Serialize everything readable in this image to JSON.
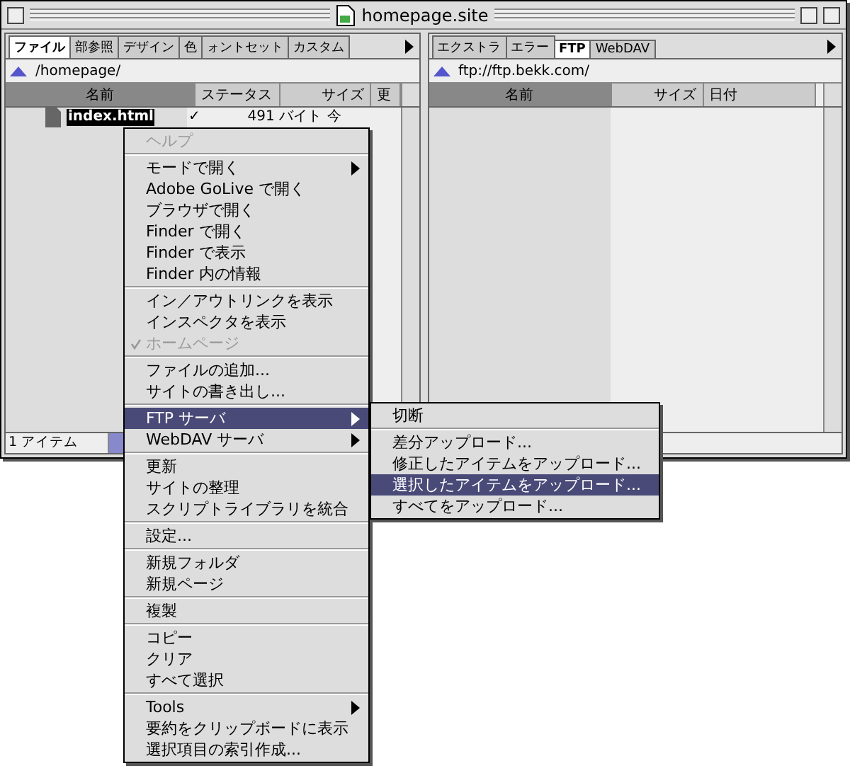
{
  "window": {
    "title": "homepage.site"
  },
  "left_pane": {
    "tabs": [
      {
        "label": "ファイル",
        "selected": true
      },
      {
        "label": "部参照",
        "selected": false
      },
      {
        "label": "デザイン",
        "selected": false
      },
      {
        "label": "色",
        "selected": false
      },
      {
        "label": "ォントセット",
        "selected": false
      },
      {
        "label": "カスタム",
        "selected": false
      }
    ],
    "path": "/homepage/",
    "columns": [
      {
        "label": "名前",
        "sorted": true
      },
      {
        "label": "ステータス",
        "sorted": false
      },
      {
        "label": "サイズ",
        "sorted": false
      },
      {
        "label": "更",
        "sorted": false
      }
    ],
    "rows": [
      {
        "name": "index.html",
        "status": "✓",
        "size": "491 バイト",
        "modified": "今",
        "selected": true
      }
    ],
    "status_bar": "1 アイテム"
  },
  "right_pane": {
    "tabs": [
      {
        "label": "エクストラ",
        "selected": false
      },
      {
        "label": "エラー",
        "selected": false
      },
      {
        "label": "FTP",
        "selected": true
      },
      {
        "label": "WebDAV",
        "selected": false
      }
    ],
    "path": "ftp://ftp.bekk.com/",
    "columns": [
      {
        "label": "名前",
        "sorted": true
      },
      {
        "label": "サイズ",
        "sorted": false
      },
      {
        "label": "日付",
        "sorted": false
      }
    ]
  },
  "context_menu": {
    "sections": [
      [
        {
          "label": "ヘルプ",
          "disabled": true,
          "checked": false,
          "submenu": false,
          "selected": false
        }
      ],
      [
        {
          "label": "モードで開く",
          "disabled": false,
          "checked": false,
          "submenu": true,
          "selected": false
        },
        {
          "label": "Adobe GoLive で開く",
          "disabled": false,
          "checked": false,
          "submenu": false,
          "selected": false
        },
        {
          "label": "ブラウザで開く",
          "disabled": false,
          "checked": false,
          "submenu": false,
          "selected": false
        },
        {
          "label": "Finder で開く",
          "disabled": false,
          "checked": false,
          "submenu": false,
          "selected": false
        },
        {
          "label": "Finder で表示",
          "disabled": false,
          "checked": false,
          "submenu": false,
          "selected": false
        },
        {
          "label": "Finder 内の情報",
          "disabled": false,
          "checked": false,
          "submenu": false,
          "selected": false
        }
      ],
      [
        {
          "label": "イン／アウトリンクを表示",
          "disabled": false,
          "checked": false,
          "submenu": false,
          "selected": false
        },
        {
          "label": "インスペクタを表示",
          "disabled": false,
          "checked": false,
          "submenu": false,
          "selected": false
        },
        {
          "label": "ホームページ",
          "disabled": true,
          "checked": true,
          "submenu": false,
          "selected": false
        }
      ],
      [
        {
          "label": "ファイルの追加...",
          "disabled": false,
          "checked": false,
          "submenu": false,
          "selected": false
        },
        {
          "label": "サイトの書き出し...",
          "disabled": false,
          "checked": false,
          "submenu": false,
          "selected": false
        }
      ],
      [
        {
          "label": "FTP サーバ",
          "disabled": false,
          "checked": false,
          "submenu": true,
          "selected": true
        },
        {
          "label": "WebDAV サーバ",
          "disabled": false,
          "checked": false,
          "submenu": true,
          "selected": false
        }
      ],
      [
        {
          "label": "更新",
          "disabled": false,
          "checked": false,
          "submenu": false,
          "selected": false
        },
        {
          "label": "サイトの整理",
          "disabled": false,
          "checked": false,
          "submenu": false,
          "selected": false
        },
        {
          "label": "スクリプトライブラリを統合",
          "disabled": false,
          "checked": false,
          "submenu": false,
          "selected": false
        }
      ],
      [
        {
          "label": "設定...",
          "disabled": false,
          "checked": false,
          "submenu": false,
          "selected": false
        }
      ],
      [
        {
          "label": "新規フォルダ",
          "disabled": false,
          "checked": false,
          "submenu": false,
          "selected": false
        },
        {
          "label": "新規ページ",
          "disabled": false,
          "checked": false,
          "submenu": false,
          "selected": false
        }
      ],
      [
        {
          "label": "複製",
          "disabled": false,
          "checked": false,
          "submenu": false,
          "selected": false
        }
      ],
      [
        {
          "label": "コピー",
          "disabled": false,
          "checked": false,
          "submenu": false,
          "selected": false
        },
        {
          "label": "クリア",
          "disabled": false,
          "checked": false,
          "submenu": false,
          "selected": false
        },
        {
          "label": "すべて選択",
          "disabled": false,
          "checked": false,
          "submenu": false,
          "selected": false
        }
      ],
      [
        {
          "label": "Tools",
          "disabled": false,
          "checked": false,
          "submenu": true,
          "selected": false
        },
        {
          "label": "要約をクリップボードに表示",
          "disabled": false,
          "checked": false,
          "submenu": false,
          "selected": false
        },
        {
          "label": "選択項目の索引作成...",
          "disabled": false,
          "checked": false,
          "submenu": false,
          "selected": false
        }
      ]
    ]
  },
  "submenu": {
    "sections": [
      [
        {
          "label": "切断",
          "selected": false
        }
      ],
      [
        {
          "label": "差分アップロード...",
          "selected": false
        },
        {
          "label": "修正したアイテムをアップロード...",
          "selected": false
        },
        {
          "label": "選択したアイテムをアップロード...",
          "selected": true
        },
        {
          "label": "すべてをアップロード...",
          "selected": false
        }
      ]
    ]
  }
}
